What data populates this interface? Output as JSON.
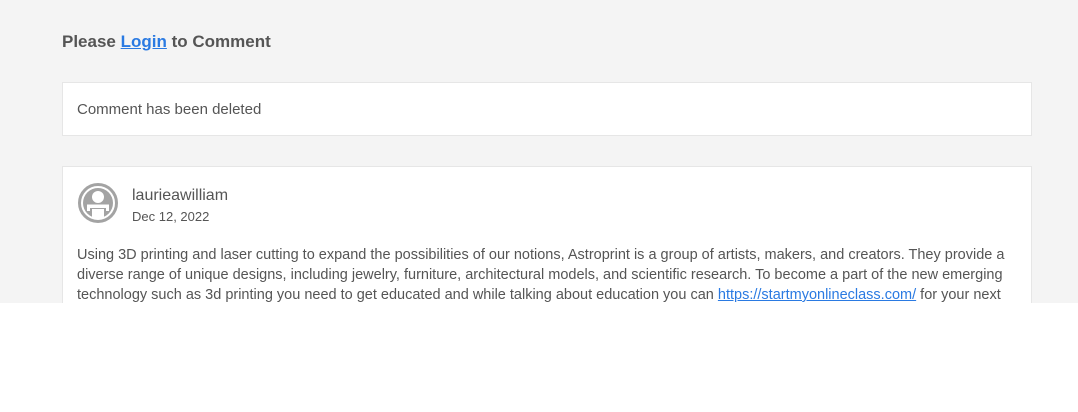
{
  "login_prompt": {
    "prefix": "Please",
    "link_label": "Login",
    "suffix": "to Comment"
  },
  "deleted_comment": {
    "text": "Comment has been deleted"
  },
  "comment": {
    "avatar_icon": "user-avatar-icon",
    "author": "laurieawilliam",
    "date": "Dec 12, 2022",
    "body_before_link": "Using 3D printing and laser cutting to expand the possibilities of our notions, Astroprint is a group of artists, makers, and creators. They provide a diverse range of unique designs, including jewelry, furniture, architectural models, and scientific research. To become a part of the new emerging technology such as 3d printing you need to get educated and while talking about education you can",
    "link_text": "https://startmyonlineclass.com/",
    "body_after_link": "for your next"
  },
  "colors": {
    "page_background": "#f4f4f4",
    "card_background": "#ffffff",
    "link": "#2a7ae2",
    "text": "#555555"
  }
}
